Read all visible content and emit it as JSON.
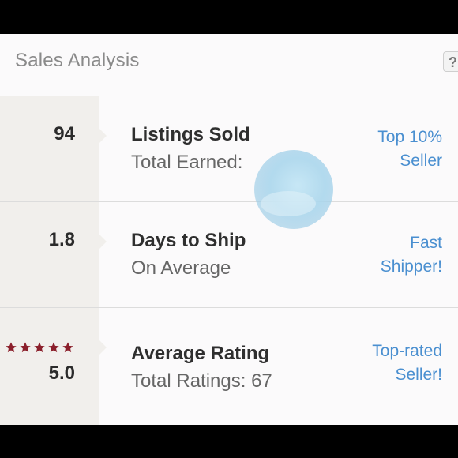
{
  "header": {
    "title": "Sales Analysis",
    "help_label": "?"
  },
  "rows": [
    {
      "stat": "94",
      "title": "Listings Sold",
      "subtitle": "Total Earned:",
      "badge_line1": "Top 10%",
      "badge_line2": "Seller"
    },
    {
      "stat": "1.8",
      "title": "Days to Ship",
      "subtitle": "On Average",
      "badge_line1": "Fast",
      "badge_line2": "Shipper!"
    },
    {
      "stat": "5.0",
      "stars": 5,
      "title": "Average Rating",
      "subtitle": "Total Ratings: 67",
      "badge_line1": "Top-rated",
      "badge_line2": "Seller!"
    }
  ],
  "colors": {
    "accent": "#4a8fd0",
    "star": "#8b1f2b",
    "stat_column": "#f1efec"
  },
  "icons": {
    "star": "star-icon",
    "help": "question-mark-icon"
  }
}
